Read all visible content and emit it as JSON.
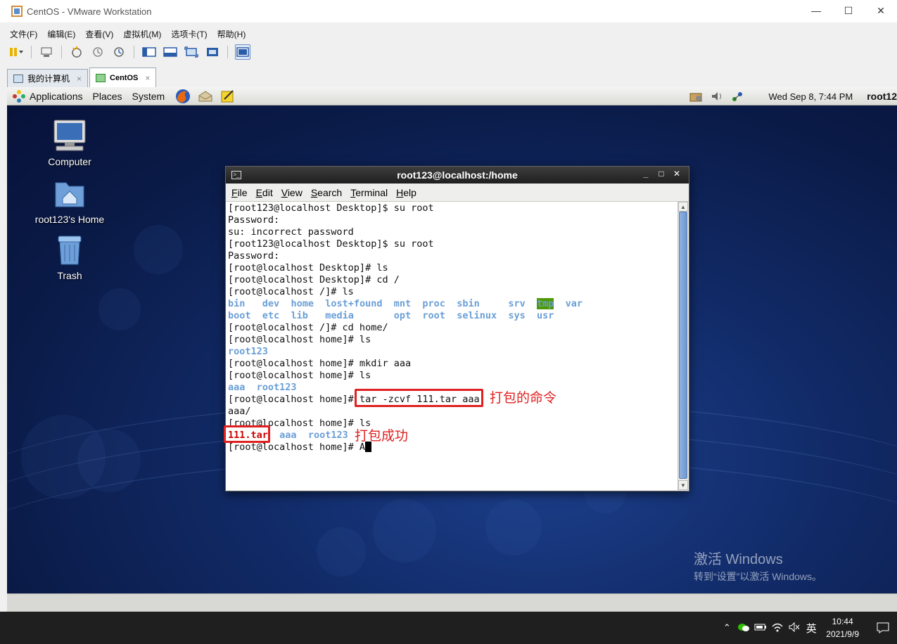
{
  "window": {
    "title": "CentOS - VMware Workstation"
  },
  "menubar": [
    "文件(F)",
    "编辑(E)",
    "查看(V)",
    "虚拟机(M)",
    "选项卡(T)",
    "帮助(H)"
  ],
  "tabs": [
    {
      "label": "我的计算机",
      "close": "×"
    },
    {
      "label": "CentOS",
      "close": "×"
    }
  ],
  "gnome_panel": {
    "menus": [
      "Applications",
      "Places",
      "System"
    ],
    "clock": "Wed Sep  8,  7:44 PM",
    "user": "root12"
  },
  "desktop_icons": [
    {
      "label": "Computer"
    },
    {
      "label": "root123's Home"
    },
    {
      "label": "Trash"
    }
  ],
  "terminal": {
    "title": "root123@localhost:/home",
    "menu": [
      {
        "u": "F",
        "rest": "ile"
      },
      {
        "u": "E",
        "rest": "dit"
      },
      {
        "u": "V",
        "rest": "iew"
      },
      {
        "u": "S",
        "rest": "earch"
      },
      {
        "u": "T",
        "rest": "erminal"
      },
      {
        "u": "H",
        "rest": "elp"
      }
    ],
    "lines": {
      "l1": "[root123@localhost Desktop]$ su root",
      "l2": "Password:",
      "l3": "su: incorrect password",
      "l4": "[root123@localhost Desktop]$ su root",
      "l5": "Password:",
      "l6": "[root@localhost Desktop]# ls",
      "l7": "[root@localhost Desktop]# cd /",
      "l8": "[root@localhost /]# ls",
      "ls_root_1": [
        "bin",
        "dev",
        "home",
        "lost+found",
        "mnt",
        "proc",
        "sbin",
        "srv",
        "tmp",
        "var"
      ],
      "ls_root_2": [
        "boot",
        "etc",
        "lib",
        "media",
        "opt",
        "root",
        "selinux",
        "sys",
        "usr"
      ],
      "l9": "[root@localhost /]# cd home/",
      "l10": "[root@localhost home]# ls",
      "ls_home_1": "root123",
      "l11": "[root@localhost home]# mkdir aaa",
      "l12": "[root@localhost home]# ls",
      "ls_home_2a": "aaa",
      "ls_home_2b": "root123",
      "l13_prompt": "[root@localhost home]# ",
      "l13_cmd": "tar -zcvf 111.tar aaa",
      "l14": "aaa/",
      "l15": "[root@localhost home]# ls",
      "ls_home_3a": "111.tar",
      "ls_home_3b": "aaa",
      "ls_home_3c": "root123",
      "l16_prompt": "[root@localhost home]# A"
    }
  },
  "annotations": {
    "cmd_note": "打包的命令",
    "result_note": "打包成功"
  },
  "activation": {
    "line1": "激活 Windows",
    "line2": "转到“设置”以激活 Windows。"
  },
  "taskbar": {
    "ime": "英",
    "time": "10:44",
    "date": "2021/9/9"
  },
  "colors": {
    "annotation_red": "#e02020",
    "directory_blue": "#6a9fd6",
    "archive_red": "#cc0000",
    "tmp_highlight": "#4e9a06"
  }
}
